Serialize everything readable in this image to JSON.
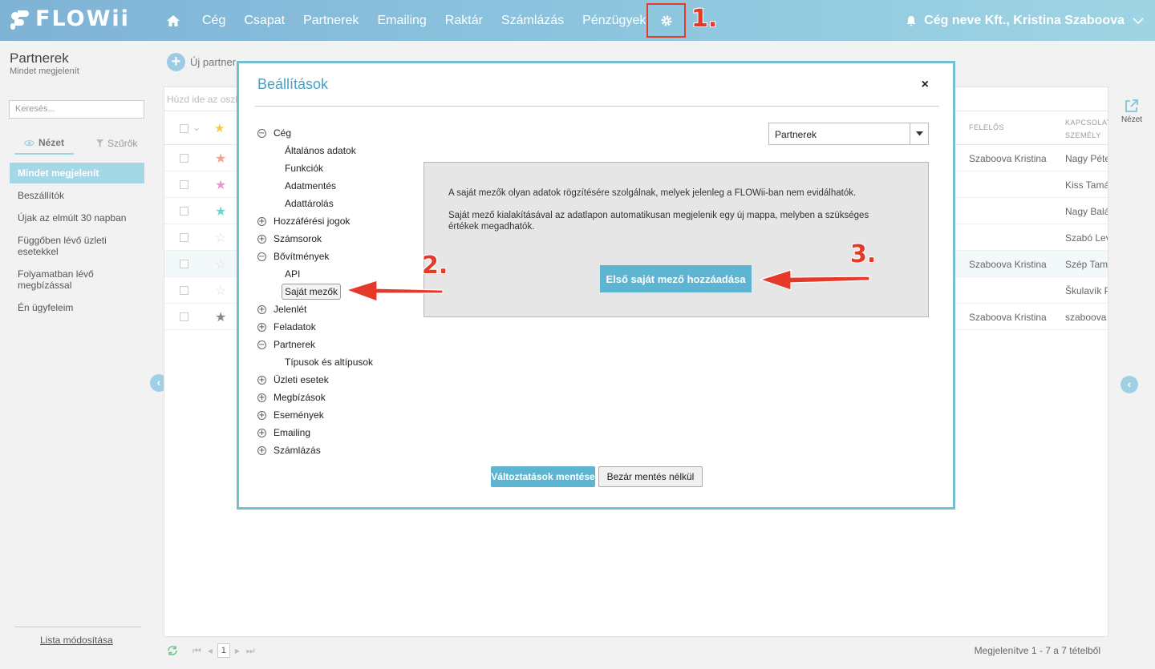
{
  "brand": {
    "name": "FLOWii"
  },
  "nav": {
    "items": [
      "Cég",
      "Csapat",
      "Partnerek",
      "Emailing",
      "Raktár",
      "Számlázás",
      "Pénzügyek"
    ],
    "user": "Cég neve Kft., Kristina Szaboova"
  },
  "steps": {
    "one": "1.",
    "two": "2.",
    "three": "3."
  },
  "sidebar": {
    "title": "Partnerek",
    "subtitle": "Mindet megjelenít",
    "search_placeholder": "Keresés...",
    "tab_view": "Nézet",
    "tab_filters": "Szűrők",
    "items": [
      "Mindet megjelenít",
      "Beszállítók",
      "Újak az elmúlt 30 napban",
      "Függőben lévő üzleti esetekkel",
      "Folyamatban lévő megbízással",
      "Én ügyfeleim"
    ],
    "footer_link": "Lista módosítása"
  },
  "toolbar": {
    "new_partner": "Új partner"
  },
  "grid": {
    "group_hint": "Húzd ide az oszl",
    "col_owner": "FELELŐS",
    "col_contact": "KAPCSOLATTARTÓ SZEMÉLY",
    "rows": [
      {
        "star": "#f2a58a",
        "owner": "Szaboova Kristina",
        "contact": "Nagy Péter"
      },
      {
        "star": "#e79ac8",
        "owner": "",
        "contact": "Kiss Tamás"
      },
      {
        "star": "#6fd6c8",
        "owner": "",
        "contact": "Nagy Balázs"
      },
      {
        "star": "none",
        "owner": "",
        "contact": "Szabó Levente"
      },
      {
        "star": "none",
        "owner": "Szaboova Kristina",
        "contact": "Szép Tamás"
      },
      {
        "star": "none",
        "owner": "",
        "contact": "Škulavík P."
      },
      {
        "star": "#888888",
        "owner": "Szaboova Kristina",
        "contact": "szaboova"
      }
    ],
    "pager_page": "1",
    "pager_info": "Megjelenítve 1 - 7 a 7 tételből"
  },
  "right_panel": {
    "view_label": "Nézet"
  },
  "modal": {
    "title": "Beállítások",
    "close": "×",
    "tree": {
      "ceg": "Cég",
      "ceg_children": [
        "Általános adatok",
        "Funkciók",
        "Adatmentés",
        "Adattárolás"
      ],
      "hozzaferesi": "Hozzáférési jogok",
      "szamsorok": "Számsorok",
      "bovitmenyek": "Bővítmények",
      "bov_api": "API",
      "bov_sajat": "Saját mezők",
      "jelenlet": "Jelenlét",
      "feladatok": "Feladatok",
      "partnerek": "Partnerek",
      "partner_child": "Típusok és altípusok",
      "uzleti": "Üzleti esetek",
      "megbizasok": "Megbízások",
      "esemenyek": "Események",
      "emailing": "Emailing",
      "szamlazas": "Számlázás"
    },
    "select_value": "Partnerek",
    "info_line1": "A saját mezők olyan adatok rögzítésére szolgálnak, melyek jelenleg a FLOWii-ban nem evidálhatók.",
    "info_line2": "Saját mező kialakításával az adatlapon automatikusan megjelenik egy új mappa, melyben a szükséges értékek megadhatók.",
    "add_button": "Első saját mező hozzáadása",
    "save_button": "Változtatások mentése",
    "close_button": "Bezár mentés nélkül"
  },
  "colors": {
    "accent": "#5eb5d1",
    "annotation": "#e53a2b",
    "selected": "#a5d8e6"
  }
}
